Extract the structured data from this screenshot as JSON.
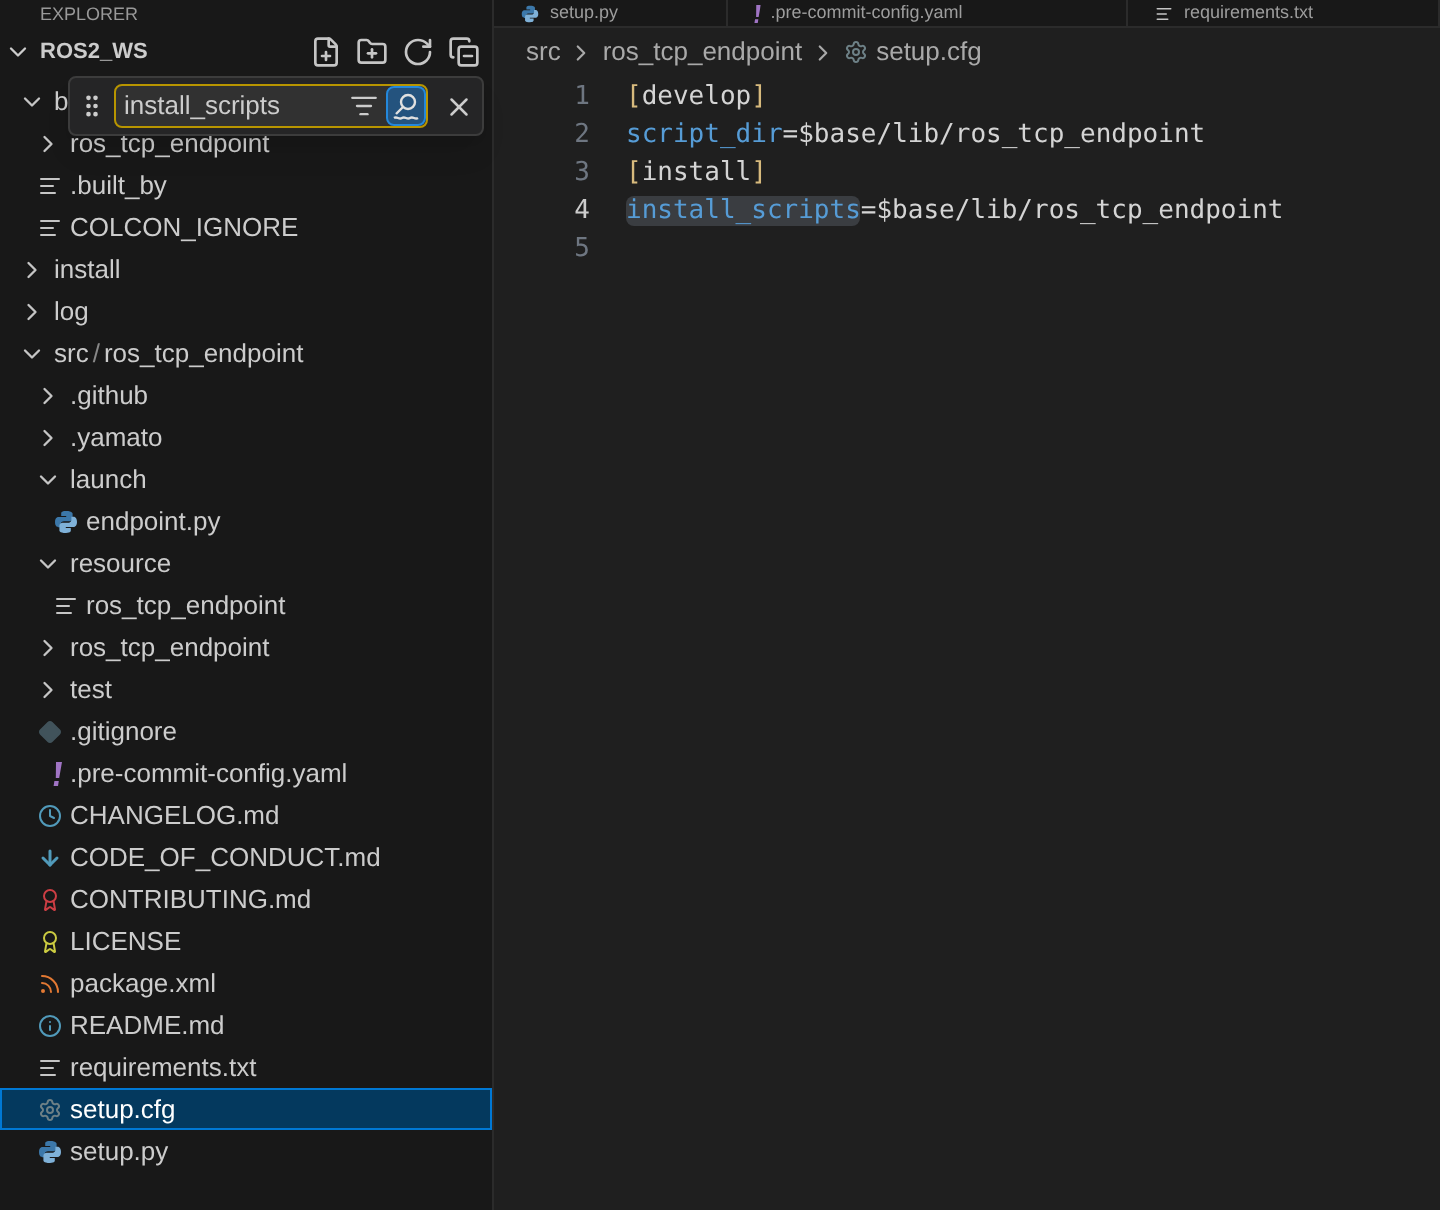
{
  "explorer": {
    "header": "EXPLORER",
    "root": {
      "label": "ROS2_WS",
      "expanded": true
    }
  },
  "tree": [
    {
      "label": "b",
      "kind": "folder",
      "expanded": true,
      "selected": false,
      "children": [
        {
          "label": "ros_tcp_endpoint",
          "kind": "folder",
          "expanded": false,
          "selected": false
        },
        {
          "label": ".built_by",
          "kind": "text",
          "selected": false
        },
        {
          "label": "COLCON_IGNORE",
          "kind": "text",
          "selected": false
        }
      ]
    },
    {
      "label": "install",
      "kind": "folder",
      "expanded": false,
      "selected": false
    },
    {
      "label": "log",
      "kind": "folder",
      "expanded": false,
      "selected": false
    },
    {
      "label": "src",
      "separator": "/",
      "label_2": "ros_tcp_endpoint",
      "kind": "folder",
      "expanded": true,
      "selected": false,
      "children": [
        {
          "label": ".github",
          "kind": "folder",
          "expanded": false,
          "selected": false
        },
        {
          "label": ".yamato",
          "kind": "folder",
          "expanded": false,
          "selected": false
        },
        {
          "label": "launch",
          "kind": "folder",
          "expanded": true,
          "selected": false,
          "children": [
            {
              "label": "endpoint.py",
              "kind": "python",
              "selected": false
            }
          ]
        },
        {
          "label": "resource",
          "kind": "folder",
          "expanded": true,
          "selected": false,
          "children": [
            {
              "label": "ros_tcp_endpoint",
              "kind": "text",
              "selected": false
            }
          ]
        },
        {
          "label": "ros_tcp_endpoint",
          "kind": "folder",
          "expanded": false,
          "selected": false
        },
        {
          "label": "test",
          "kind": "folder",
          "expanded": false,
          "selected": false
        },
        {
          "label": ".gitignore",
          "kind": "git",
          "selected": false
        },
        {
          "label": ".pre-commit-config.yaml",
          "kind": "yaml",
          "selected": false
        },
        {
          "label": "CHANGELOG.md",
          "kind": "changelog",
          "selected": false
        },
        {
          "label": "CODE_OF_CONDUCT.md",
          "kind": "conduct",
          "selected": false
        },
        {
          "label": "CONTRIBUTING.md",
          "kind": "contributing",
          "selected": false
        },
        {
          "label": "LICENSE",
          "kind": "license",
          "selected": false
        },
        {
          "label": "package.xml",
          "kind": "xml",
          "selected": false
        },
        {
          "label": "README.md",
          "kind": "info",
          "selected": false
        },
        {
          "label": "requirements.txt",
          "kind": "text",
          "selected": false
        },
        {
          "label": "setup.cfg",
          "kind": "config",
          "selected": true
        },
        {
          "label": "setup.py",
          "kind": "python",
          "selected": false
        }
      ]
    }
  ],
  "find_widget": {
    "value": "install_scripts",
    "fuzzy_match": true
  },
  "tabs": [
    {
      "label": "setup.py",
      "kind": "python",
      "selected": false
    },
    {
      "label": ".pre-commit-config.yaml",
      "kind": "yaml",
      "selected": false
    },
    {
      "label": "requirements.txt",
      "kind": "text",
      "selected": false
    }
  ],
  "breadcrumbs": [
    {
      "label": "src",
      "kind": "folder"
    },
    {
      "label": "ros_tcp_endpoint",
      "kind": "folder"
    },
    {
      "label": "setup.cfg",
      "kind": "config"
    }
  ],
  "code": [
    {
      "number": "1",
      "current": false,
      "tokens": [
        {
          "text": "[",
          "kind": "bracket",
          "highlighted": false
        },
        {
          "text": "develop",
          "kind": "section",
          "highlighted": false
        },
        {
          "text": "]",
          "kind": "bracket",
          "highlighted": false
        }
      ]
    },
    {
      "number": "2",
      "current": false,
      "tokens": [
        {
          "text": "script_dir",
          "kind": "key",
          "highlighted": false
        },
        {
          "text": "=$base/lib/ros_tcp_endpoint",
          "kind": "value",
          "highlighted": false
        }
      ]
    },
    {
      "number": "3",
      "current": false,
      "tokens": [
        {
          "text": "[",
          "kind": "bracket",
          "highlighted": false
        },
        {
          "text": "install",
          "kind": "section",
          "highlighted": false
        },
        {
          "text": "]",
          "kind": "bracket",
          "highlighted": false
        }
      ]
    },
    {
      "number": "4",
      "current": true,
      "tokens": [
        {
          "text": "install_scripts",
          "kind": "key",
          "highlighted": true
        },
        {
          "text": "=$base/lib/ros_tcp_endpoint",
          "kind": "value",
          "highlighted": false
        }
      ]
    },
    {
      "number": "5",
      "current": false
    }
  ]
}
